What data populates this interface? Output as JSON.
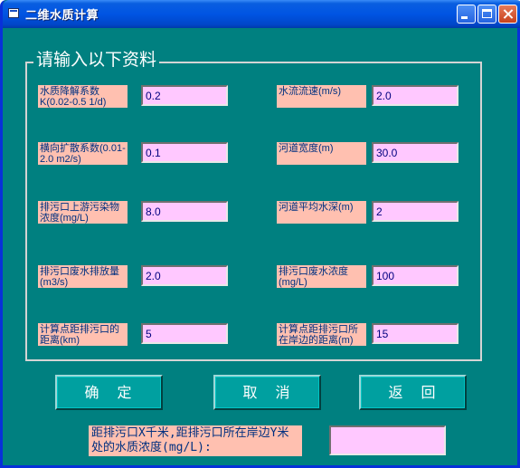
{
  "window": {
    "title": "二维水质计算"
  },
  "group": {
    "title": "请输入以下资料"
  },
  "fields": {
    "decay_coef": {
      "label": "水质降解系数K(0.02-0.5 1/d)",
      "value": "0.2"
    },
    "diffusion_coef": {
      "label": "横向扩散系数(0.01-2.0 m2/s)",
      "value": "0.1"
    },
    "upstream_conc": {
      "label": "排污口上游污染物浓度(mg/L)",
      "value": "8.0"
    },
    "discharge_flow": {
      "label": "排污口废水排放量(m3/s)",
      "value": "2.0"
    },
    "dist_downstream": {
      "label": "计算点距排污口的距离(km)",
      "value": "5"
    },
    "flow_velocity": {
      "label": "水流流速(m/s)",
      "value": "2.0"
    },
    "river_width": {
      "label": "河道宽度(m)",
      "value": "30.0"
    },
    "river_depth": {
      "label": "河道平均水深(m)",
      "value": "2"
    },
    "wastewater_conc": {
      "label": "排污口废水浓度(mg/L)",
      "value": "100"
    },
    "dist_bank": {
      "label": "计算点距排污口所在岸边的距离(m)",
      "value": "15"
    }
  },
  "buttons": {
    "ok": "确　定",
    "cancel": "取　消",
    "back": "返　回"
  },
  "result": {
    "label": "距排污口X千米,距排污口所在岸边Y米处的水质浓度(mg/L):",
    "value": ""
  },
  "colors": {
    "window_bg": "#008080",
    "label_bg": "#ffc0b0",
    "input_bg": "#ffc8ff",
    "titlebar": "#0054e3"
  }
}
